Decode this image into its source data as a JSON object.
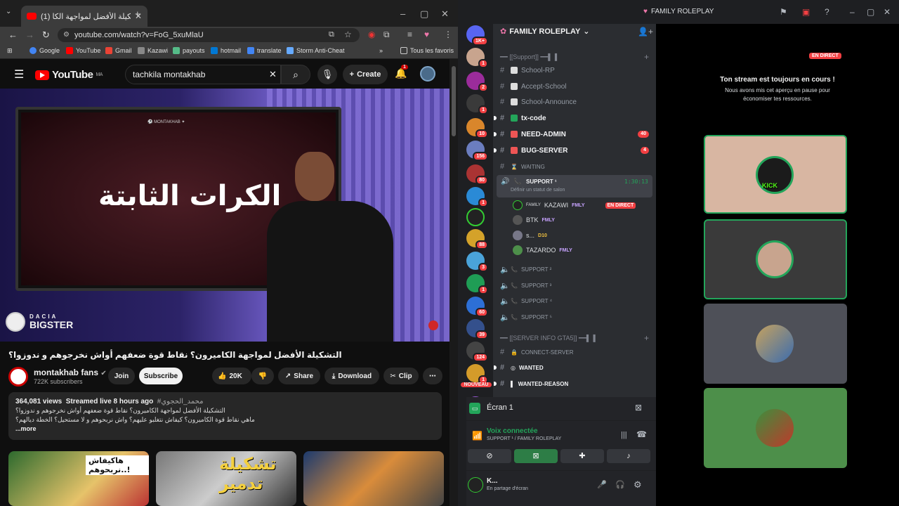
{
  "chrome": {
    "tab_title": "(1) التشكيلة الأفضل لمواجهة الكا",
    "url": "youtube.com/watch?v=FoG_5xuMlaU",
    "bookmarks": [
      "Google",
      "YouTube",
      "Gmail",
      "Kazawi",
      "payouts",
      "hotmail",
      "translate",
      "Storm Anti-Cheat"
    ],
    "bookmarks_more": "»",
    "all_bookmarks": "Tous les favoris"
  },
  "youtube": {
    "logo_text": "YouTube",
    "logo_region": "MA",
    "search_value": "tachkila montakhab",
    "create_label": "Create",
    "notif_count": "1",
    "video_screen_text": "الكرات الثابتة",
    "brand_top": "DACIA",
    "brand_bottom": "BIGSTER",
    "video_title": "التشكيلة الأفضل لمواجهة الكاميرون؟ نقاط قوة ضعفهم أواش نخرجوهم و ندوزوا؟",
    "channel_name": "montakhab fans",
    "subscribers": "722K subscribers",
    "join_label": "Join",
    "subscribe_label": "Subscribe",
    "likes": "20K",
    "share_label": "Share",
    "download_label": "Download",
    "clip_label": "Clip",
    "views": "364,081 views",
    "streamed": "Streamed live 8 hours ago",
    "hashtag": "#محمد_الحجوي",
    "desc_line1": "التشكيلة الأفضل لمواجهة الكاميرون؟ نقاط قوة ضعفهم أواش نخرجوهم و ندوزوا؟",
    "desc_line2": "ماهي نقاط قوة الكاميرون؟ كيفاش نتغلبو عليهم؟ واش نربحوهم و لا مستحيل؟ الخطة ديالهم؟",
    "more_label": "...more",
    "thumb1_caption": "هاكيفاش نربحوهم..!",
    "thumb2_caption": "تشكيلة تدمير"
  },
  "discord": {
    "window_title": "FAMILY ROLEPLAY",
    "server_name": "FAMILY ROLEPLAY",
    "guild_badges": [
      "1K+",
      "1",
      "2",
      "1",
      "10",
      "156",
      "80",
      "1",
      "",
      "88",
      "3",
      "1",
      "60",
      "39",
      "124",
      "1"
    ],
    "nouveau": "NOUVEAU",
    "category_support": "╾━╤デ╦︻[Support]︻╦デ╤━╾",
    "category_support_short": "━━ [[Support]] ━━▌▐",
    "channels": [
      {
        "name": "School-RP",
        "unread": false
      },
      {
        "name": "Accept-School",
        "unread": false
      },
      {
        "name": "School-Announce",
        "unread": false
      },
      {
        "name": "tx-code",
        "unread": true,
        "count": ""
      },
      {
        "name": "NEED-ADMIN",
        "unread": true,
        "count": "40"
      },
      {
        "name": "BUG-SERVER",
        "unread": true,
        "count": "4"
      },
      {
        "name": "WAITING",
        "unread": false,
        "count": ""
      }
    ],
    "voice_active": {
      "name": "SUPPORT ¹",
      "timer": "1:30:13",
      "status_hint": "Définir un statut de salon"
    },
    "voice_members": [
      {
        "name": "KAZAWI",
        "prefix": "FAMILY",
        "tag": "FMLY",
        "live": "EN DIRECT"
      },
      {
        "name": "BTK",
        "tag": "FMLY"
      },
      {
        "name": "s...",
        "tag": "D10"
      },
      {
        "name": "TAZARDO",
        "tag": "FMLY"
      }
    ],
    "other_voice": [
      "SUPPORT ²",
      "SUPPORT ³",
      "SUPPORT ⁴",
      "SUPPORT ⁵"
    ],
    "category_info": "━━ [[SERVER INFO GTA5]] ━━▌▐",
    "info_channels": [
      "CONNECT-SERVER",
      "WANTED",
      "WANTED-REASON"
    ],
    "screen_share": "Écran 1",
    "voice_connected": "Voix connectée",
    "voice_location": "SUPPORT ¹ / FAMILY ROLEPLAY",
    "user_name": "K...",
    "user_status": "En partage d'écran",
    "stage_live": "EN DIRECT",
    "stage_title": "Ton stream est toujours en cours !",
    "stage_sub1": "Nous avons mis cet aperçu en pause pour",
    "stage_sub2": "économiser tes ressources.",
    "tile1_label": "KICK",
    "colors": {
      "bg": "#1e1f22",
      "sidebar": "#2b2d31",
      "red": "#f23f42",
      "green": "#23a55a",
      "tile1": "#d8b6a2",
      "tile2": "#3a3a3a",
      "tile3": "#4e5058",
      "tile4": "#4d8f4a"
    }
  }
}
